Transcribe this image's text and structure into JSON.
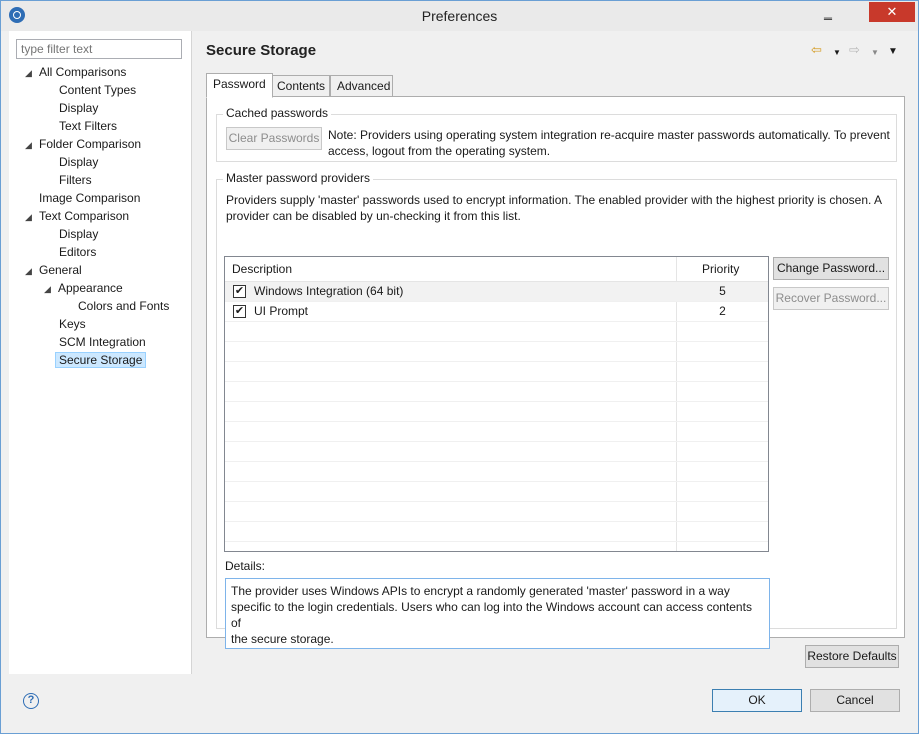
{
  "window": {
    "title": "Preferences",
    "minimize_glyph": "‗",
    "close_glyph": "✕",
    "accent_color": "#2e6db5"
  },
  "sidebar": {
    "filter_placeholder": "type filter text",
    "items": [
      {
        "label": "All Comparisons",
        "expanded": true
      },
      {
        "label": "Content Types"
      },
      {
        "label": "Display"
      },
      {
        "label": "Text Filters"
      },
      {
        "label": "Folder Comparison",
        "expanded": true
      },
      {
        "label": "Display"
      },
      {
        "label": "Filters"
      },
      {
        "label": "Image Comparison"
      },
      {
        "label": "Text Comparison",
        "expanded": true
      },
      {
        "label": "Display"
      },
      {
        "label": "Editors"
      },
      {
        "label": "General",
        "expanded": true
      },
      {
        "label": "Appearance",
        "expanded": true
      },
      {
        "label": "Colors and Fonts"
      },
      {
        "label": "Keys"
      },
      {
        "label": "SCM Integration"
      },
      {
        "label": "Secure Storage",
        "selected": true
      }
    ]
  },
  "main": {
    "page_title": "Secure Storage",
    "nav": {
      "back_icon": "back-arrow-icon",
      "forward_icon": "forward-arrow-icon",
      "menu_icon": "view-menu-icon"
    },
    "tabs": [
      {
        "label": "Password",
        "active": true
      },
      {
        "label": "Contents"
      },
      {
        "label": "Advanced"
      }
    ],
    "cached": {
      "title": "Cached passwords",
      "clear_button": "Clear Passwords",
      "note_line1": "Note: Providers using operating system integration re-acquire master passwords automatically. To prevent",
      "note_line2": "access, logout from the operating system."
    },
    "master": {
      "title": "Master password providers",
      "desc_line1": "Providers supply 'master' passwords used to encrypt information. The enabled provider with the highest priority is chosen. A",
      "desc_line2": "provider can be disabled by un-checking it from this list.",
      "columns": [
        "Description",
        "Priority"
      ],
      "rows": [
        {
          "description": "Windows Integration (64 bit)",
          "priority": "5",
          "checked": true
        },
        {
          "description": "UI Prompt",
          "priority": "2",
          "checked": true
        }
      ],
      "change_button": "Change Password...",
      "recover_button": "Recover Password...",
      "details_label": "Details:",
      "details_text_line1": "The provider uses Windows APIs to encrypt a randomly generated 'master' password in a way",
      "details_text_line2": "specific to the login credentials. Users who can log into the Windows account can access contents of",
      "details_text_line3": "the secure storage."
    },
    "restore_button": "Restore Defaults"
  },
  "footer": {
    "help_glyph": "?",
    "ok_button": "OK",
    "cancel_button": "Cancel"
  }
}
